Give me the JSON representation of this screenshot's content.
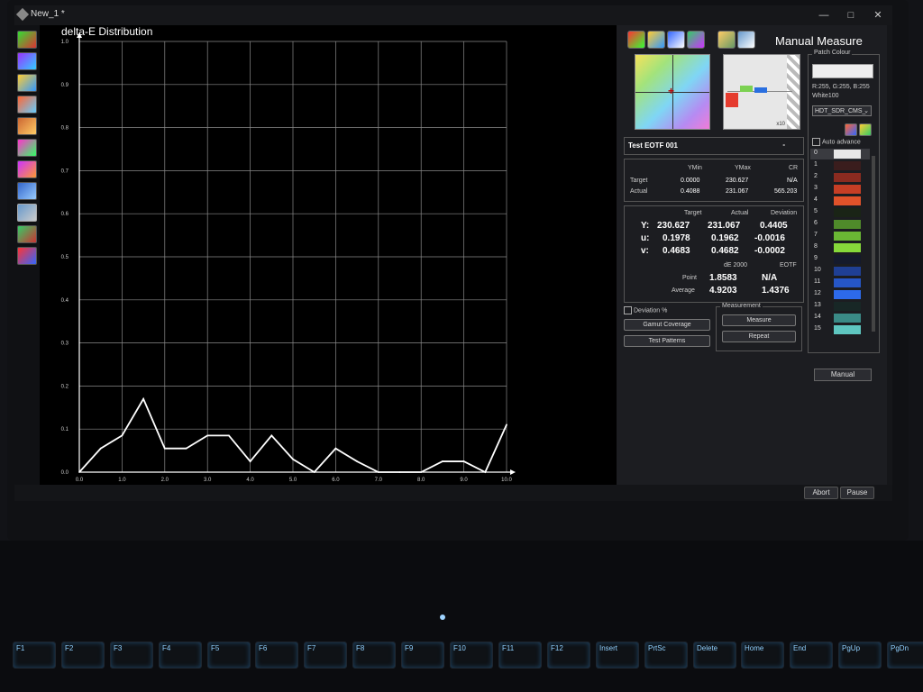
{
  "window": {
    "title": "New_1 *",
    "min_glyph": "—",
    "max_glyph": "□",
    "close_glyph": "✕"
  },
  "chart_data": {
    "type": "line",
    "title": "delta-E Distribution",
    "x": [
      0.0,
      0.5,
      1.0,
      1.5,
      2.0,
      2.5,
      3.0,
      3.5,
      4.0,
      4.5,
      5.0,
      5.5,
      6.0,
      6.5,
      7.0,
      7.5,
      8.0,
      8.5,
      9.0,
      9.5,
      10.0
    ],
    "y": [
      0.0,
      0.055,
      0.085,
      0.17,
      0.055,
      0.055,
      0.085,
      0.085,
      0.025,
      0.085,
      0.03,
      0.0,
      0.055,
      0.025,
      0.0,
      0.0,
      0.0,
      0.025,
      0.025,
      0.0,
      0.11
    ],
    "xlim": [
      0,
      10
    ],
    "ylim": [
      0,
      1.0
    ],
    "xticks": [
      "0.0",
      "1.0",
      "2.0",
      "3.0",
      "4.0",
      "5.0",
      "6.0",
      "7.0",
      "8.0",
      "9.0",
      "10.0"
    ],
    "yticks": [
      "0.0",
      "0.1",
      "0.2",
      "0.3",
      "0.4",
      "0.5",
      "0.6",
      "0.7",
      "0.8",
      "0.9",
      "1.0"
    ],
    "grid": true,
    "line_color": "#ffffff"
  },
  "panel": {
    "title": "Manual Measure",
    "test_name": "Test EOTF 001",
    "test_dash": "-",
    "patch_preview_zoom": "x10",
    "ytable": {
      "headers": [
        "YMin",
        "YMax",
        "CR"
      ],
      "rows": [
        {
          "label": "Target",
          "ymin": "0.0000",
          "ymax": "230.627",
          "cr": "N/A"
        },
        {
          "label": "Actual",
          "ymin": "0.4088",
          "ymax": "231.067",
          "cr": "565.203"
        }
      ]
    },
    "meas": {
      "headers": [
        "Target",
        "Actual",
        "Deviation"
      ],
      "rows": [
        {
          "label": "Y:",
          "target": "230.627",
          "actual": "231.067",
          "deviation": "0.4405"
        },
        {
          "label": "u:",
          "target": "0.1978",
          "actual": "0.1962",
          "deviation": "-0.0016"
        },
        {
          "label": "v:",
          "target": "0.4683",
          "actual": "0.4682",
          "deviation": "-0.0002"
        }
      ],
      "de_header": "dE 2000",
      "eotf_header": "EOTF",
      "point_label": "Point",
      "point_de": "1.8583",
      "point_eotf": "N/A",
      "avg_label": "Average",
      "avg_de": "4.9203",
      "avg_eotf": "1.4376"
    },
    "deviation_pct": "Deviation %",
    "gamut_btn": "Gamut Coverage",
    "testpat_btn": "Test Patterns",
    "measurement_group": "Measurement",
    "measure_btn": "Measure",
    "repeat_btn": "Repeat",
    "patch_colour": {
      "legend": "Patch Colour",
      "rgb": "R:255, G:255, B:255",
      "name": "White100",
      "profile": "HDT_SDR_CMS_",
      "auto_advance": "Auto advance",
      "manual_btn": "Manual",
      "patches": [
        {
          "num": "0",
          "color": "#e8e8e8"
        },
        {
          "num": "1",
          "color": "#3a1d1d"
        },
        {
          "num": "2",
          "color": "#8a2b20"
        },
        {
          "num": "3",
          "color": "#c63e25"
        },
        {
          "num": "4",
          "color": "#e0522a"
        },
        {
          "num": "5",
          "color": "#1a2416"
        },
        {
          "num": "6",
          "color": "#4f8a2a"
        },
        {
          "num": "7",
          "color": "#6ab734"
        },
        {
          "num": "8",
          "color": "#86d83a"
        },
        {
          "num": "9",
          "color": "#151a2c"
        },
        {
          "num": "10",
          "color": "#1f3f94"
        },
        {
          "num": "11",
          "color": "#2656c6"
        },
        {
          "num": "12",
          "color": "#2d6aea"
        },
        {
          "num": "13",
          "color": "#182726"
        },
        {
          "num": "14",
          "color": "#3a8a86"
        },
        {
          "num": "15",
          "color": "#5ec6c0"
        }
      ]
    }
  },
  "status": {
    "abort": "Abort",
    "pause": "Pause"
  },
  "keyboard": {
    "keys": [
      "F1",
      "F2",
      "F3",
      "F4",
      "F5",
      "F6",
      "F7",
      "F8",
      "F9",
      "F10",
      "F11",
      "F12",
      "Insert",
      "PrtSc",
      "Delete",
      "Home",
      "End",
      "PgUp",
      "PgDn"
    ]
  }
}
